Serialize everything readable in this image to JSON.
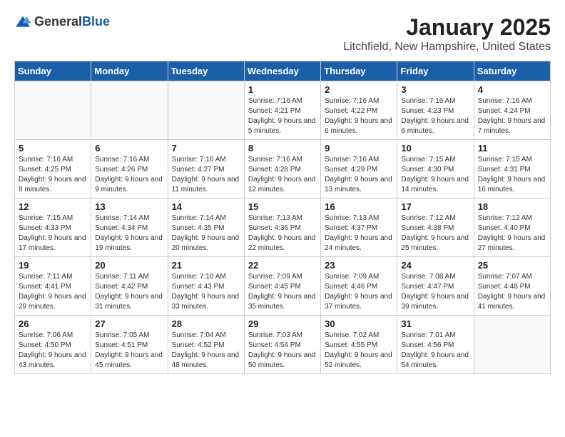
{
  "header": {
    "logo_general": "General",
    "logo_blue": "Blue",
    "month": "January 2025",
    "location": "Litchfield, New Hampshire, United States"
  },
  "weekdays": [
    "Sunday",
    "Monday",
    "Tuesday",
    "Wednesday",
    "Thursday",
    "Friday",
    "Saturday"
  ],
  "weeks": [
    [
      {
        "day": "",
        "info": ""
      },
      {
        "day": "",
        "info": ""
      },
      {
        "day": "",
        "info": ""
      },
      {
        "day": "1",
        "info": "Sunrise: 7:16 AM\nSunset: 4:21 PM\nDaylight: 9 hours and 5 minutes."
      },
      {
        "day": "2",
        "info": "Sunrise: 7:16 AM\nSunset: 4:22 PM\nDaylight: 9 hours and 6 minutes."
      },
      {
        "day": "3",
        "info": "Sunrise: 7:16 AM\nSunset: 4:23 PM\nDaylight: 9 hours and 6 minutes."
      },
      {
        "day": "4",
        "info": "Sunrise: 7:16 AM\nSunset: 4:24 PM\nDaylight: 9 hours and 7 minutes."
      }
    ],
    [
      {
        "day": "5",
        "info": "Sunrise: 7:16 AM\nSunset: 4:25 PM\nDaylight: 9 hours and 8 minutes."
      },
      {
        "day": "6",
        "info": "Sunrise: 7:16 AM\nSunset: 4:26 PM\nDaylight: 9 hours and 9 minutes."
      },
      {
        "day": "7",
        "info": "Sunrise: 7:16 AM\nSunset: 4:27 PM\nDaylight: 9 hours and 11 minutes."
      },
      {
        "day": "8",
        "info": "Sunrise: 7:16 AM\nSunset: 4:28 PM\nDaylight: 9 hours and 12 minutes."
      },
      {
        "day": "9",
        "info": "Sunrise: 7:16 AM\nSunset: 4:29 PM\nDaylight: 9 hours and 13 minutes."
      },
      {
        "day": "10",
        "info": "Sunrise: 7:15 AM\nSunset: 4:30 PM\nDaylight: 9 hours and 14 minutes."
      },
      {
        "day": "11",
        "info": "Sunrise: 7:15 AM\nSunset: 4:31 PM\nDaylight: 9 hours and 16 minutes."
      }
    ],
    [
      {
        "day": "12",
        "info": "Sunrise: 7:15 AM\nSunset: 4:33 PM\nDaylight: 9 hours and 17 minutes."
      },
      {
        "day": "13",
        "info": "Sunrise: 7:14 AM\nSunset: 4:34 PM\nDaylight: 9 hours and 19 minutes."
      },
      {
        "day": "14",
        "info": "Sunrise: 7:14 AM\nSunset: 4:35 PM\nDaylight: 9 hours and 20 minutes."
      },
      {
        "day": "15",
        "info": "Sunrise: 7:13 AM\nSunset: 4:36 PM\nDaylight: 9 hours and 22 minutes."
      },
      {
        "day": "16",
        "info": "Sunrise: 7:13 AM\nSunset: 4:37 PM\nDaylight: 9 hours and 24 minutes."
      },
      {
        "day": "17",
        "info": "Sunrise: 7:12 AM\nSunset: 4:38 PM\nDaylight: 9 hours and 25 minutes."
      },
      {
        "day": "18",
        "info": "Sunrise: 7:12 AM\nSunset: 4:40 PM\nDaylight: 9 hours and 27 minutes."
      }
    ],
    [
      {
        "day": "19",
        "info": "Sunrise: 7:11 AM\nSunset: 4:41 PM\nDaylight: 9 hours and 29 minutes."
      },
      {
        "day": "20",
        "info": "Sunrise: 7:11 AM\nSunset: 4:42 PM\nDaylight: 9 hours and 31 minutes."
      },
      {
        "day": "21",
        "info": "Sunrise: 7:10 AM\nSunset: 4:43 PM\nDaylight: 9 hours and 33 minutes."
      },
      {
        "day": "22",
        "info": "Sunrise: 7:09 AM\nSunset: 4:45 PM\nDaylight: 9 hours and 35 minutes."
      },
      {
        "day": "23",
        "info": "Sunrise: 7:09 AM\nSunset: 4:46 PM\nDaylight: 9 hours and 37 minutes."
      },
      {
        "day": "24",
        "info": "Sunrise: 7:08 AM\nSunset: 4:47 PM\nDaylight: 9 hours and 39 minutes."
      },
      {
        "day": "25",
        "info": "Sunrise: 7:07 AM\nSunset: 4:48 PM\nDaylight: 9 hours and 41 minutes."
      }
    ],
    [
      {
        "day": "26",
        "info": "Sunrise: 7:06 AM\nSunset: 4:50 PM\nDaylight: 9 hours and 43 minutes."
      },
      {
        "day": "27",
        "info": "Sunrise: 7:05 AM\nSunset: 4:51 PM\nDaylight: 9 hours and 45 minutes."
      },
      {
        "day": "28",
        "info": "Sunrise: 7:04 AM\nSunset: 4:52 PM\nDaylight: 9 hours and 48 minutes."
      },
      {
        "day": "29",
        "info": "Sunrise: 7:03 AM\nSunset: 4:54 PM\nDaylight: 9 hours and 50 minutes."
      },
      {
        "day": "30",
        "info": "Sunrise: 7:02 AM\nSunset: 4:55 PM\nDaylight: 9 hours and 52 minutes."
      },
      {
        "day": "31",
        "info": "Sunrise: 7:01 AM\nSunset: 4:56 PM\nDaylight: 9 hours and 54 minutes."
      },
      {
        "day": "",
        "info": ""
      }
    ]
  ]
}
